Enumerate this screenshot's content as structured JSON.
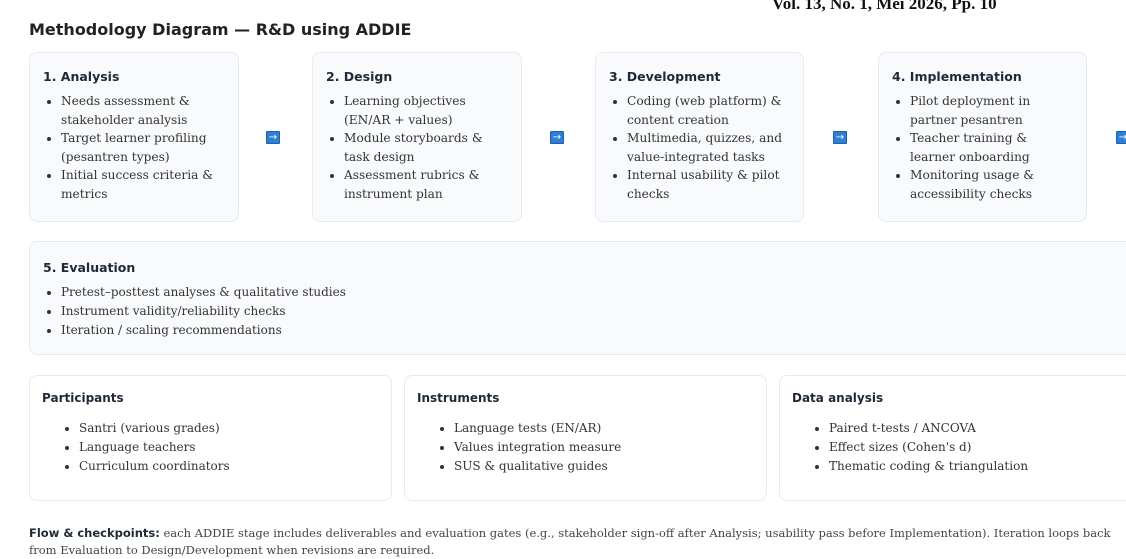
{
  "journal_header": "Vol. 13, No. 1, Mei 2026, Pp. 10",
  "title": "Methodology Diagram — R&D using ADDIE",
  "arrow_glyph": "→",
  "stages": [
    {
      "title": "1. Analysis",
      "items": [
        "Needs assessment & stakeholder analysis",
        "Target learner profiling (pesantren types)",
        "Initial success criteria & metrics"
      ]
    },
    {
      "title": "2. Design",
      "items": [
        "Learning objectives (EN/AR + values)",
        "Module storyboards & task design",
        "Assessment rubrics & instrument plan"
      ]
    },
    {
      "title": "3. Development",
      "items": [
        "Coding (web platform) & content creation",
        "Multimedia, quizzes, and value-integrated tasks",
        "Internal usability & pilot checks"
      ]
    },
    {
      "title": "4. Implementation",
      "items": [
        "Pilot deployment in partner pesantren",
        "Teacher training & learner onboarding",
        "Monitoring usage & accessibility checks"
      ]
    }
  ],
  "evaluation": {
    "title": "5. Evaluation",
    "items": [
      "Pretest–posttest analyses & qualitative studies",
      "Instrument validity/reliability checks",
      "Iteration / scaling recommendations"
    ]
  },
  "panels": [
    {
      "title": "Participants",
      "items": [
        "Santri (various grades)",
        "Language teachers",
        "Curriculum coordinators"
      ]
    },
    {
      "title": "Instruments",
      "items": [
        "Language tests (EN/AR)",
        "Values integration measure",
        "SUS & qualitative guides"
      ]
    },
    {
      "title": "Data analysis",
      "items": [
        "Paired t-tests / ANCOVA",
        "Effect sizes (Cohen's d)",
        "Thematic coding & triangulation"
      ]
    }
  ],
  "footnote": {
    "label": "Flow & checkpoints:",
    "text": " each ADDIE stage includes deliverables and evaluation gates (e.g., stakeholder sign-off after Analysis; usability pass before Implementation). Iteration loops back from Evaluation to Design/Development when revisions are required."
  }
}
